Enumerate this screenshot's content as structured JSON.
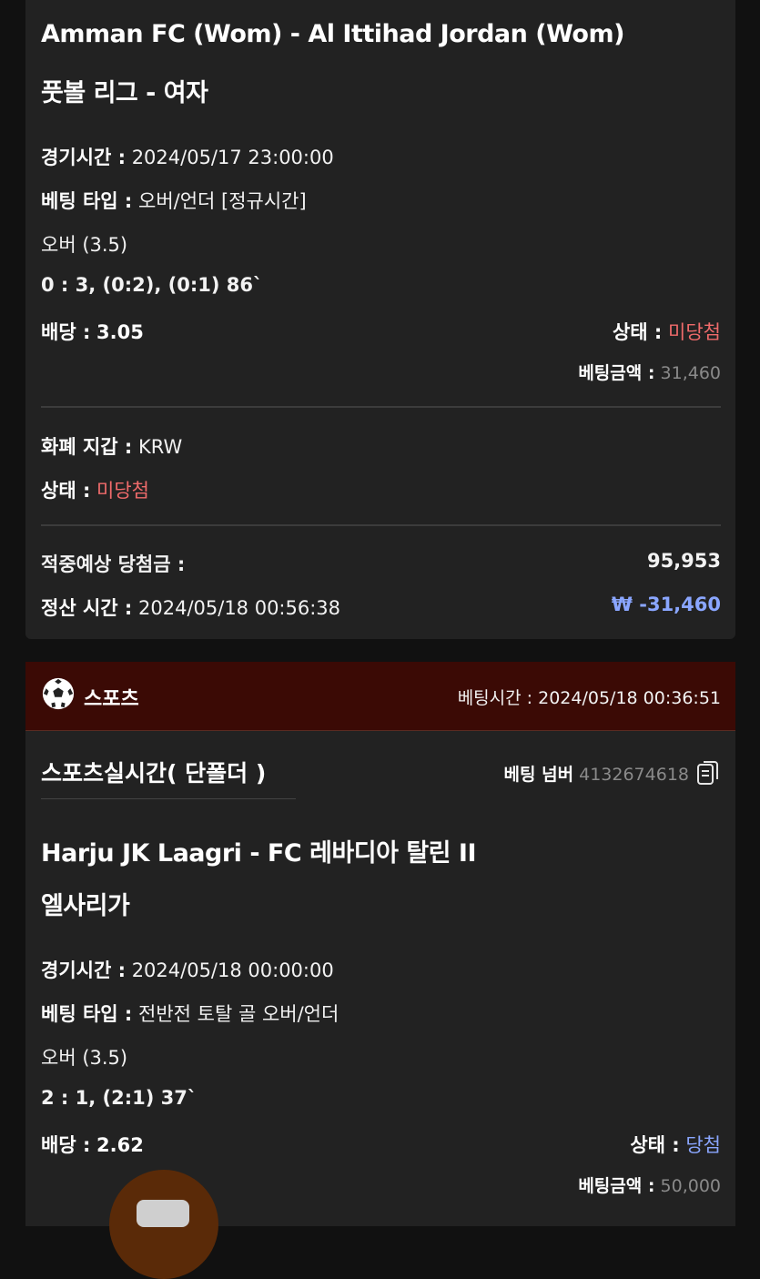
{
  "bet1": {
    "match": "Amman FC (Wom) - Al Ittihad Jordan (Wom)",
    "league": "풋볼 리그 - 여자",
    "game_time_label": "경기시간 :",
    "game_time": "2024/05/17 23:00:00",
    "bet_type_label": "베팅 타입 :",
    "bet_type": "오버/언더 [정규시간]",
    "selection": "오버 (3.5)",
    "score": "0 : 3, (0:2), (0:1) 86`",
    "odds_label": "배당 :",
    "odds": "3.05",
    "status_label": "상태 :",
    "status": "미당첨",
    "amount_label": "베팅금액 :",
    "amount": "31,460",
    "wallet_label": "화폐 지갑 :",
    "wallet": "KRW",
    "status2_label": "상태 :",
    "status2": "미당첨",
    "expected_label": "적중예상 당첨금 :",
    "expected": "95,953",
    "settle_label": "정산 시간 :",
    "settle_time": "2024/05/18 00:56:38",
    "settle_amount": "₩ -31,460"
  },
  "bet2": {
    "category": "스포츠",
    "bet_time_label": "베팅시간 :",
    "bet_time": "2024/05/18 00:36:51",
    "type_title": "스포츠실시간( 단폴더 )",
    "bet_number_label": "베팅 넘버",
    "bet_number": "4132674618",
    "match": "Harju JK Laagri - FC 레바디아 탈린 II",
    "league": "엘사리가",
    "game_time_label": "경기시간 :",
    "game_time": "2024/05/18 00:00:00",
    "bet_type_label": "베팅 타입 :",
    "bet_type": "전반전 토탈 골 오버/언더",
    "selection": "오버 (3.5)",
    "score": "2 : 1, (2:1) 37`",
    "odds_label": "배당 :",
    "odds": "2.62",
    "status_label": "상태 :",
    "status": "당첨",
    "amount_label": "베팅금액 :",
    "amount": "50,000"
  },
  "colors": {
    "lose": "#f06b6b",
    "win": "#8aa6ff",
    "header": "#3b0a05"
  },
  "icons": [
    "soccer-ball-icon",
    "copy-icon"
  ]
}
